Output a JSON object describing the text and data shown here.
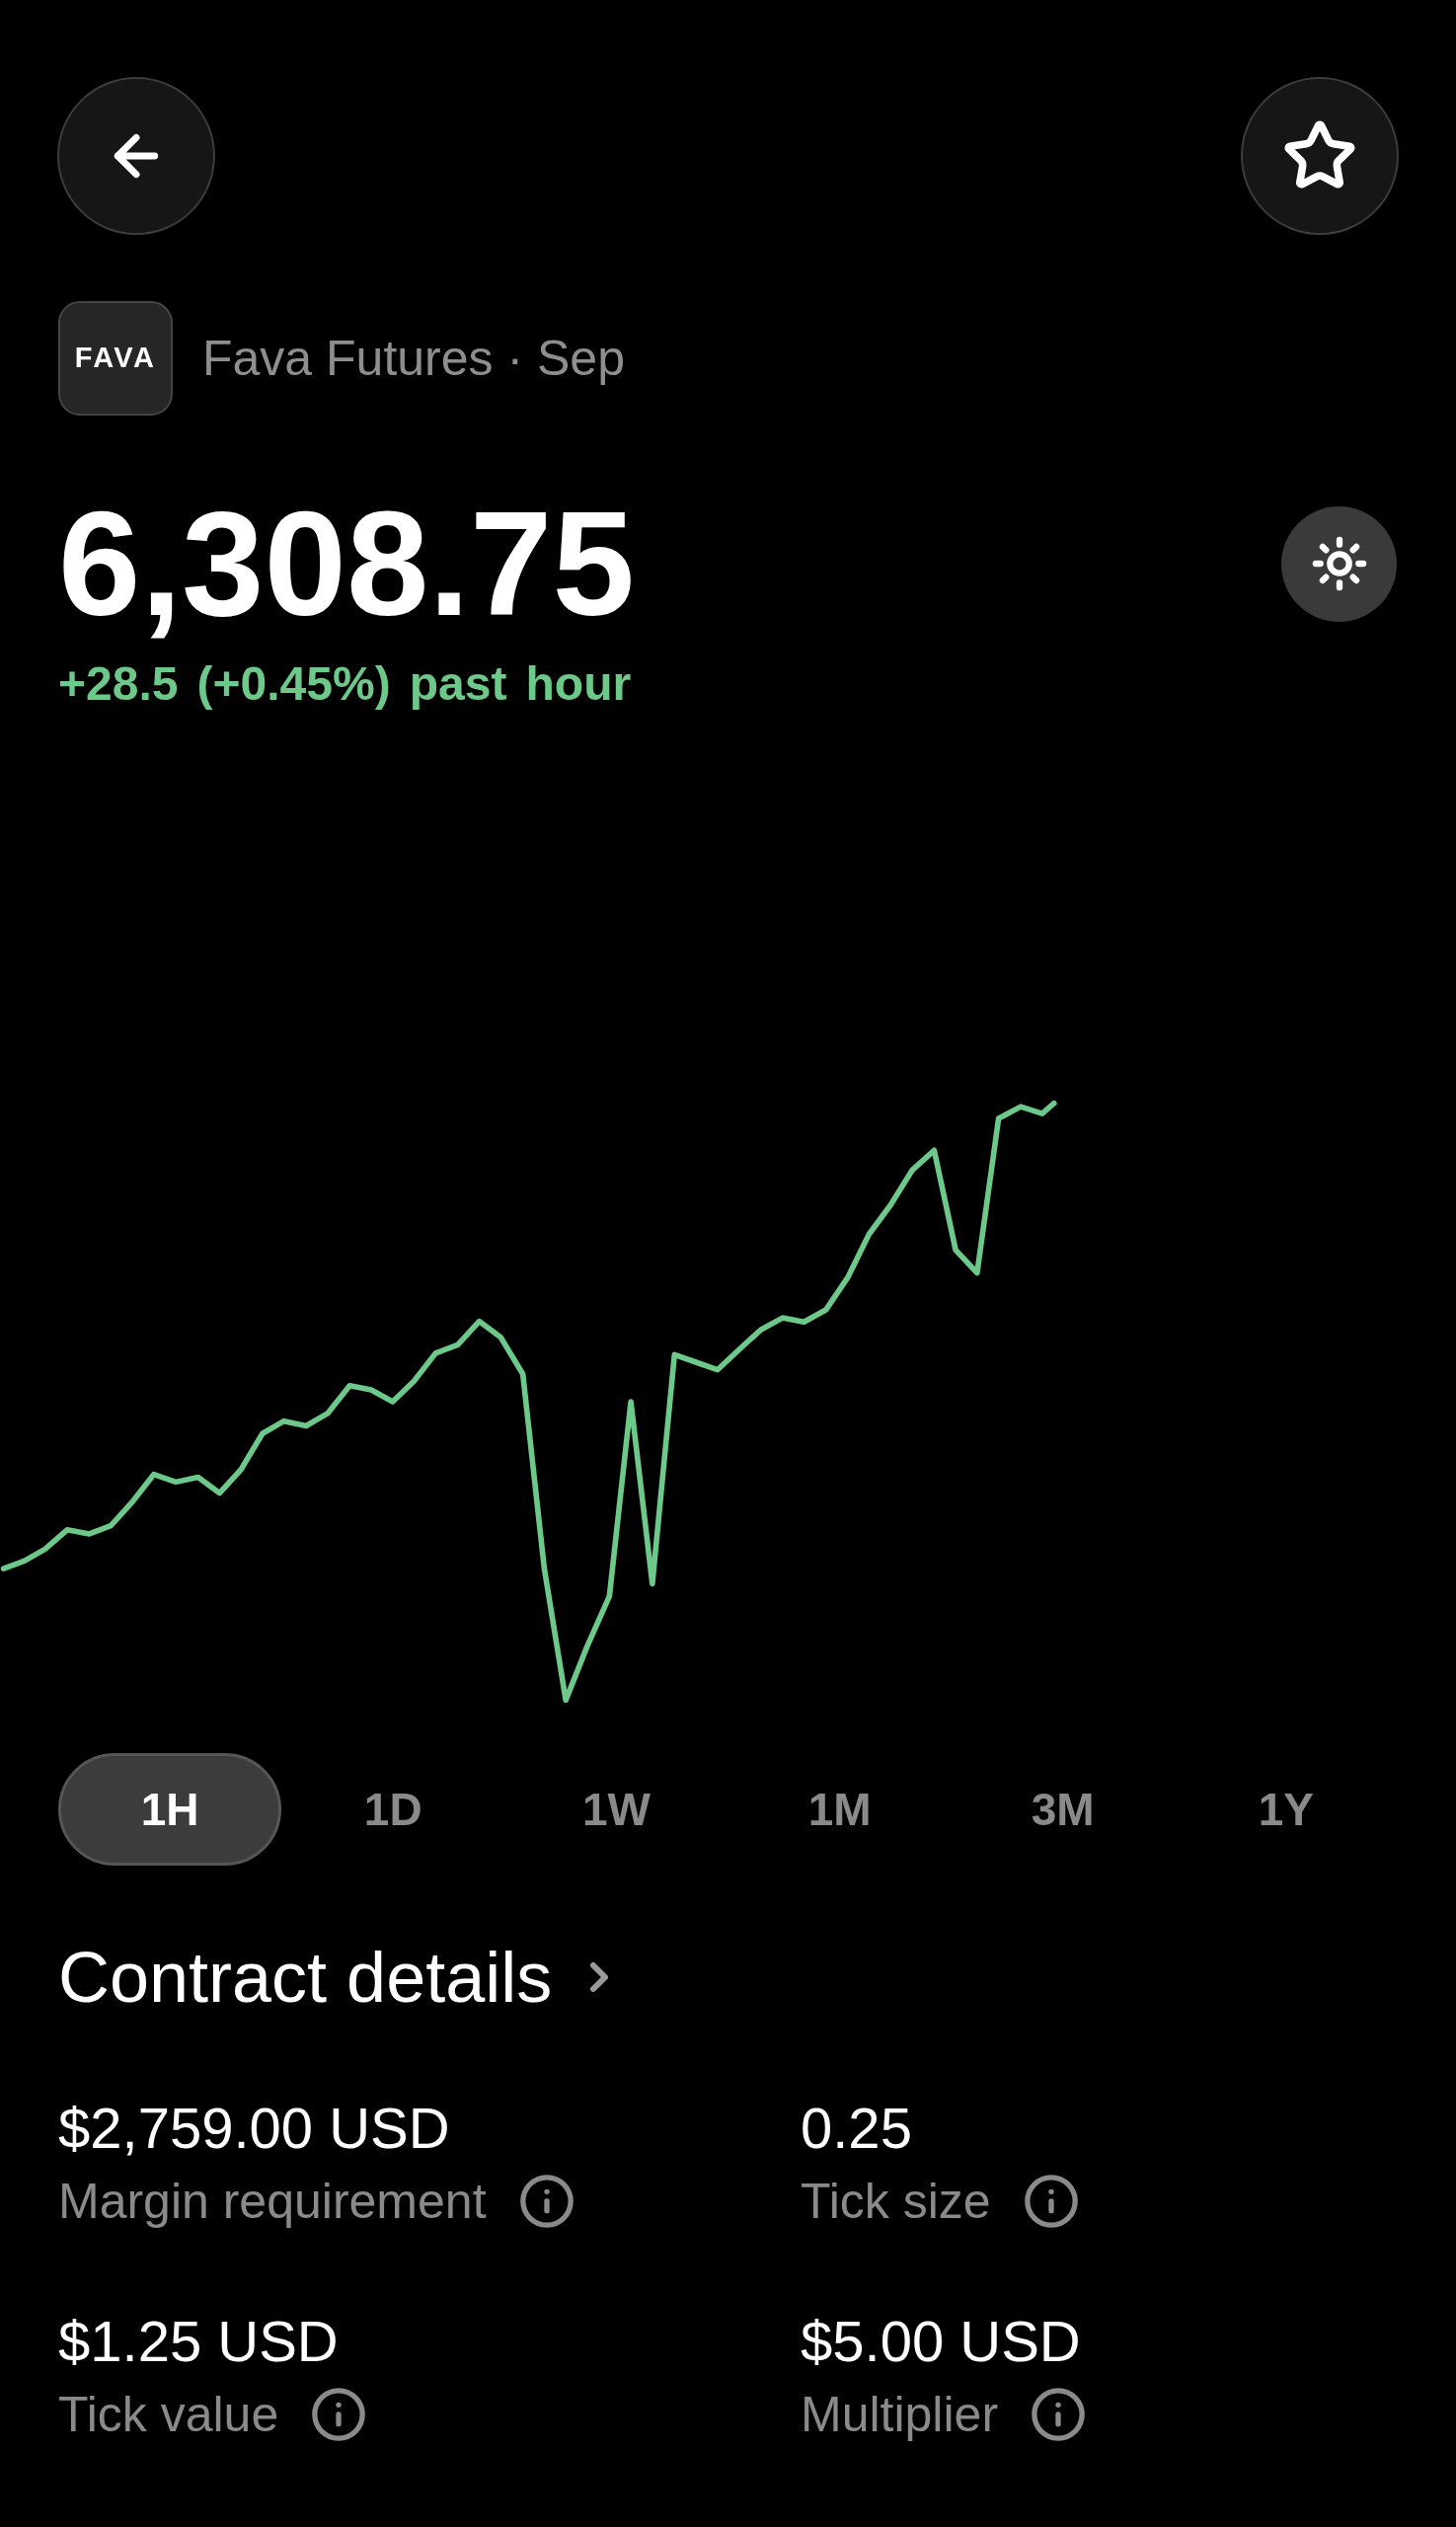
{
  "favorite": {
    "on": false
  },
  "instrument": {
    "logo": "FAVA",
    "name": "Fava Futures · Sep"
  },
  "quote": {
    "price": "6,308.75",
    "change": "+28.5 (+0.45%) past hour"
  },
  "ranges": [
    {
      "label": "1H",
      "selected": true
    },
    {
      "label": "1D",
      "selected": false
    },
    {
      "label": "1W",
      "selected": false
    },
    {
      "label": "1M",
      "selected": false
    },
    {
      "label": "3M",
      "selected": false
    },
    {
      "label": "1Y",
      "selected": false
    }
  ],
  "contract_details": {
    "title": "Contract details",
    "items": [
      {
        "value": "$2,759.00 USD",
        "label": "Margin requirement"
      },
      {
        "value": "0.25",
        "label": "Tick size"
      },
      {
        "value": "$1.25 USD",
        "label": "Tick value"
      },
      {
        "value": "$5.00 USD",
        "label": "Multiplier"
      }
    ]
  }
}
